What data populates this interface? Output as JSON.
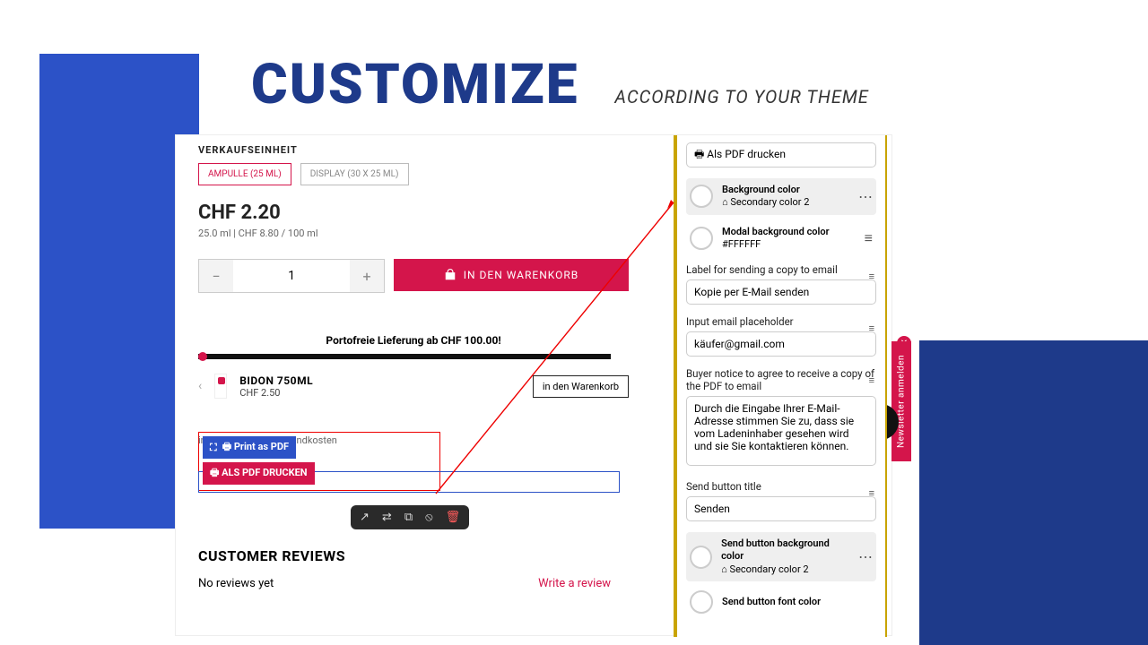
{
  "hero": {
    "title": "CUSTOMIZE",
    "subtitle": "ACCORDING TO YOUR THEME"
  },
  "product": {
    "variant_label": "VERKAUFSEINHEIT",
    "variants": [
      "AMPULLE (25 ML)",
      "DISPLAY (30 X 25 ML)"
    ],
    "price": "CHF 2.20",
    "unit_price": "25.0 ml | CHF 8.80 / 100 ml",
    "qty": "1",
    "add_to_cart": "IN DEN WARENKORB",
    "free_ship": "Portofreie Lieferung ab CHF 100.00!",
    "cross": {
      "name": "BIDON 750ML",
      "price": "CHF 2.50",
      "add": "in den Warenkorb"
    },
    "newsletter_tab": "Newsletter anmelden",
    "tax_note": "inkl. MwSt. zzgl. Versandkosten",
    "print_blue": "🖶 Print as PDF",
    "print_red": "🖶 ALS PDF DRUCKEN",
    "reviews_heading": "CUSTOMER REVIEWS",
    "no_reviews": "No reviews yet",
    "write_review": "Write a review"
  },
  "toolbar_icons": [
    "↗",
    "⇄",
    "⧉",
    "⦸",
    "🗑"
  ],
  "panel": {
    "top_input": "🖶 Als PDF drucken",
    "bg_color": {
      "title": "Background color",
      "sub": "Secondary color 2"
    },
    "modal_bg": {
      "title": "Modal background color",
      "sub": "#FFFFFF"
    },
    "email_label_label": "Label for sending a copy to email",
    "email_label_value": "Kopie per E-Mail senden",
    "email_ph_label": "Input email placeholder",
    "email_ph_value": "käufer@gmail.com",
    "notice_label": "Buyer notice to agree to receive a copy of the PDF to email",
    "notice_value": "Durch die Eingabe Ihrer E-Mail-Adresse stimmen Sie zu, dass sie vom Ladeninhaber gesehen wird und sie Sie kontaktieren können.",
    "send_label": "Send button title",
    "send_value": "Senden",
    "send_bg": {
      "title": "Send button background color",
      "sub": "Secondary color 2"
    },
    "send_font": "Send button font color"
  }
}
